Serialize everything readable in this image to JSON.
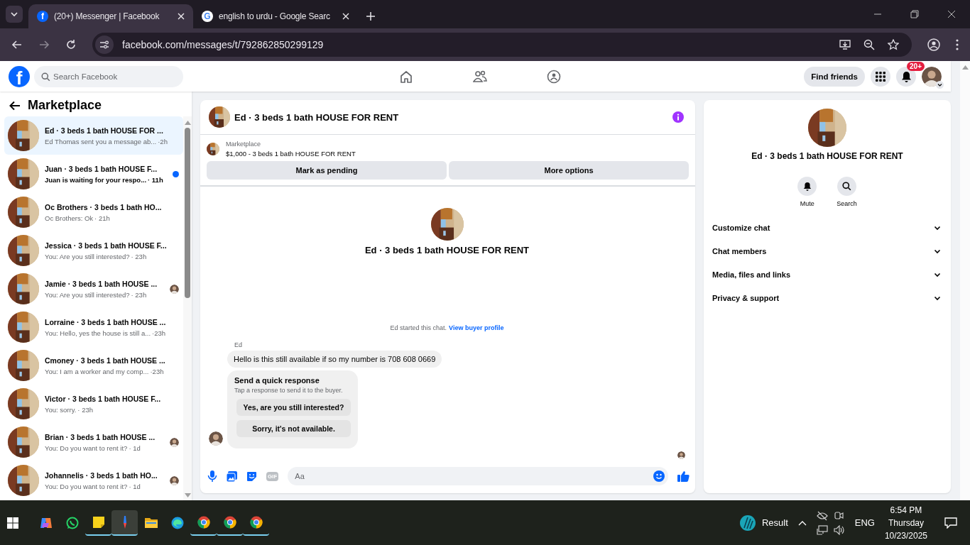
{
  "browser": {
    "tabs": [
      {
        "favicon": "f",
        "kind": "facebook",
        "title": "(20+) Messenger | Facebook",
        "selected": true
      },
      {
        "favicon": "G",
        "kind": "google",
        "title": "english to urdu - Google Searc",
        "selected": false
      }
    ],
    "url": "facebook.com/messages/t/792862850299129"
  },
  "topbar": {
    "logo": "f",
    "search_placeholder": "Search Facebook",
    "find_friends": "Find friends",
    "notification_badge": "20+"
  },
  "sidebar": {
    "title": "Marketplace",
    "conversations": [
      {
        "title": "Ed · 3 beds 1 bath HOUSE FOR ...",
        "preview": "Ed Thomas sent you a message ab...",
        "time": "·2h",
        "selected": true,
        "unread": false,
        "seen": false
      },
      {
        "title": "Juan · 3 beds 1 bath HOUSE F...",
        "preview": "Juan is waiting for your respo...",
        "time": "· 11h",
        "selected": false,
        "unread": true,
        "seen": false
      },
      {
        "title": "Oc Brothers · 3 beds 1 bath HO...",
        "preview": "Oc Brothers: Ok",
        "time": "· 21h",
        "selected": false,
        "unread": false,
        "seen": false
      },
      {
        "title": "Jessica · 3 beds 1 bath HOUSE F...",
        "preview": "You: Are you still interested?",
        "time": "· 23h",
        "selected": false,
        "unread": false,
        "seen": false
      },
      {
        "title": "Jamie · 3 beds 1 bath HOUSE ...",
        "preview": "You: Are you still interested?",
        "time": "· 23h",
        "selected": false,
        "unread": false,
        "seen": true
      },
      {
        "title": "Lorraine · 3 beds 1 bath HOUSE ...",
        "preview": "You: Hello, yes the house is still a...",
        "time": "·23h",
        "selected": false,
        "unread": false,
        "seen": false
      },
      {
        "title": "Cmoney · 3 beds 1 bath HOUSE ...",
        "preview": "You: I am a worker and my comp...",
        "time": "·23h",
        "selected": false,
        "unread": false,
        "seen": false
      },
      {
        "title": "Victor · 3 beds 1 bath HOUSE F...",
        "preview": "You: sorry.",
        "time": "· 23h",
        "selected": false,
        "unread": false,
        "seen": false
      },
      {
        "title": "Brian · 3 beds 1 bath HOUSE ...",
        "preview": "You: Do you want to rent it?",
        "time": "· 1d",
        "selected": false,
        "unread": false,
        "seen": true
      },
      {
        "title": "Johannelis · 3 beds 1 bath HO...",
        "preview": "You: Do you want to rent it?",
        "time": "· 1d",
        "selected": false,
        "unread": false,
        "seen": true
      }
    ]
  },
  "chat": {
    "title": "Ed · 3 beds 1 bath HOUSE FOR RENT",
    "listing": {
      "label": "Marketplace",
      "summary": "$1,000 - 3 beds 1 bath HOUSE FOR RENT",
      "actions": [
        "Mark as pending",
        "More options"
      ]
    },
    "intro_title": "Ed · 3 beds 1 bath HOUSE FOR RENT",
    "started": "Ed started this chat.",
    "buyer_link": "View buyer profile",
    "sender": "Ed",
    "message": "Hello is this still available if so my number is 708 608 0669",
    "quick": {
      "title": "Send a quick response",
      "hint": "Tap a response to send it to the buyer.",
      "responses": [
        "Yes, are you still interested?",
        "Sorry, it's not available."
      ]
    },
    "gif_label": "GIF",
    "composer_placeholder": "Aa"
  },
  "details": {
    "title": "Ed · 3 beds 1 bath HOUSE FOR RENT",
    "actions": [
      {
        "label": "Mute",
        "kind": "bell"
      },
      {
        "label": "Search",
        "kind": "search"
      }
    ],
    "sections": [
      {
        "label": "Customize chat",
        "expanded": false
      },
      {
        "label": "Chat members",
        "expanded": false
      },
      {
        "label": "Media, files and links",
        "expanded": false
      },
      {
        "label": "Privacy & support",
        "expanded": false
      }
    ]
  },
  "taskbar": {
    "apps": [
      {
        "kind": "copilot",
        "running": false,
        "selected": false
      },
      {
        "kind": "whatsapp",
        "running": false,
        "selected": false
      },
      {
        "kind": "notes",
        "running": true,
        "selected": false
      },
      {
        "kind": "tool",
        "running": true,
        "selected": true
      },
      {
        "kind": "folder",
        "running": false,
        "selected": false
      },
      {
        "kind": "edge",
        "running": false,
        "selected": false
      },
      {
        "kind": "chrome",
        "running": true,
        "selected": false
      },
      {
        "kind": "chrome",
        "running": true,
        "selected": false
      },
      {
        "kind": "chrome",
        "running": true,
        "selected": false
      }
    ],
    "weather": "Result",
    "language": "ENG",
    "time": "6:54 PM",
    "day": "Thursday",
    "date": "10/23/2025"
  }
}
